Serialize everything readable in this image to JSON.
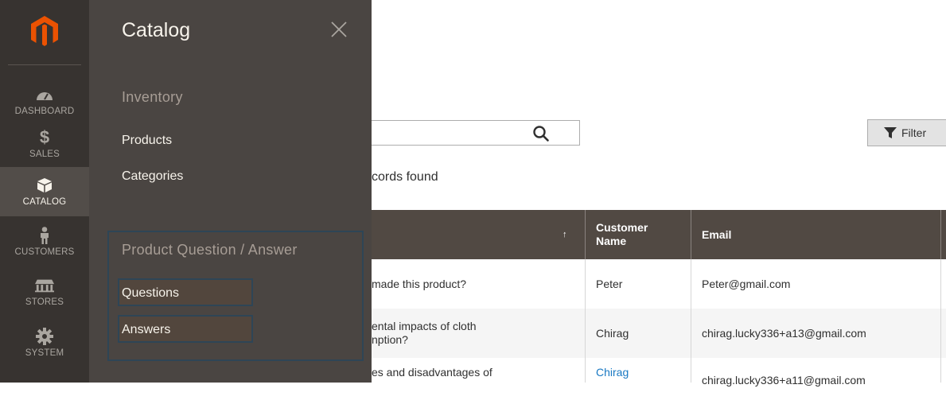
{
  "nav": {
    "items": [
      {
        "label": "DASHBOARD",
        "icon": "dashboard-icon"
      },
      {
        "label": "$",
        "sub": "SALES",
        "icon": "dollar-icon"
      },
      {
        "label": "CATALOG",
        "icon": "box-icon"
      },
      {
        "label": "CUSTOMERS",
        "icon": "person-icon"
      },
      {
        "label": "STORES",
        "icon": "store-icon"
      },
      {
        "label": "SYSTEM",
        "icon": "gear-icon"
      }
    ]
  },
  "panel": {
    "title": "Catalog",
    "sections": [
      {
        "title": "Inventory",
        "links": [
          "Products",
          "Categories"
        ]
      },
      {
        "title": "Product Question / Answer",
        "links": [
          "Questions",
          "Answers"
        ]
      }
    ]
  },
  "content": {
    "filters_label": "Filter",
    "records_text": "cords found",
    "columns": {
      "question_sort": "↑",
      "customer_name": "Customer\nName",
      "email": "Email"
    },
    "rows": [
      {
        "question": "made this product?",
        "customer": "Peter",
        "email": "Peter@gmail.com"
      },
      {
        "question": "ental impacts of cloth\nnption?",
        "customer": "Chirag",
        "email": "chirag.lucky336+a13@gmail.com"
      },
      {
        "question": "es and disadvantages of",
        "customer": "Chirag",
        "email": "chirag.lucky336+a11@gmail.com"
      }
    ]
  },
  "colors": {
    "nav_bg": "#373330",
    "panel_bg": "#4a4542",
    "logo_orange": "#eb5202",
    "table_header": "#514943",
    "link_blue": "#1979c3",
    "highlight_border": "#2e4556"
  }
}
